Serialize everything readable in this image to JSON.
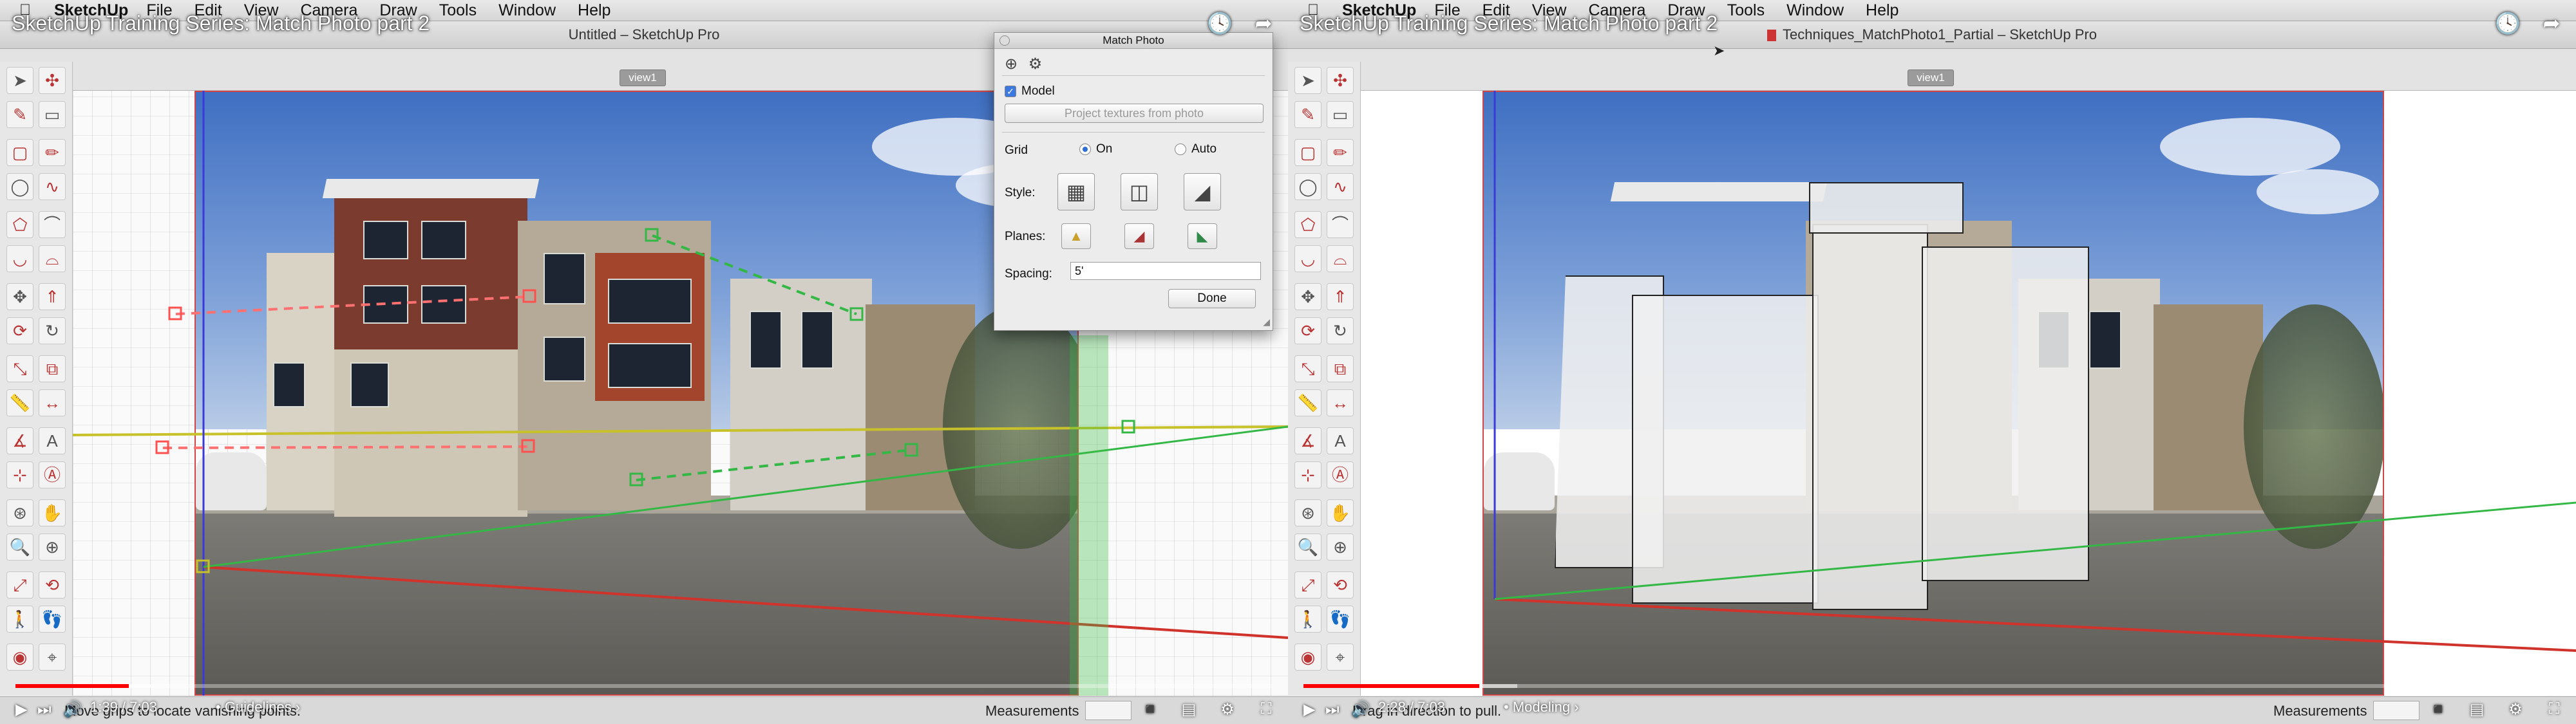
{
  "menu": {
    "apple": "",
    "app": "SketchUp",
    "items": [
      "File",
      "Edit",
      "View",
      "Camera",
      "Draw",
      "Tools",
      "Window",
      "Help"
    ]
  },
  "video_title": "SketchUp Training Series: Match Photo part 2",
  "left": {
    "window_title": "Untitled – SketchUp Pro",
    "scene_tab": "view1",
    "status_hint": "Move grips to locate vanishing points.",
    "measurements_label": "Measurements",
    "time": "1:39 / 7:03",
    "chapter": "• Guidelines ›",
    "progress_played": 0.09,
    "progress_buffered": 0.11
  },
  "right": {
    "window_title": "Techniques_MatchPhoto1_Partial – SketchUp Pro",
    "scene_tab": "view1",
    "status_hint": "Drag in direction to pull.",
    "measurements_label": "Measurements",
    "time": "2:28 / 7:03",
    "chapter": "• Modeling ›",
    "progress_played": 0.14,
    "progress_buffered": 0.17
  },
  "dialog": {
    "title": "Match Photo",
    "model_label": "Model",
    "model_checked": true,
    "project_button": "Project textures from photo",
    "grid_label": "Grid",
    "grid_on": "On",
    "grid_auto": "Auto",
    "grid_selected": "On",
    "style_label": "Style:",
    "planes_label": "Planes:",
    "spacing_label": "Spacing:",
    "spacing_value": "5'",
    "done_button": "Done"
  },
  "colors": {
    "axis_red": "#d0332b",
    "axis_green": "#34b845",
    "axis_blue": "#3a3ad8",
    "horizon": "#c8c22a",
    "youtube_red": "#ff0000"
  },
  "icons": {
    "left_tools": [
      "select-arrow-icon",
      "paint-bucket-icon",
      "paint-icon",
      "eraser-icon",
      "rectangle-icon",
      "pencil-icon",
      "circle-icon",
      "freehand-icon",
      "polygon-icon",
      "arc-icon",
      "shape-icon",
      "arc2-icon",
      "move-icon",
      "push-pull-icon",
      "rotate-icon",
      "follow-me-icon",
      "scale-icon",
      "offset-icon",
      "tape-measure-icon",
      "dimension-icon",
      "protractor-icon",
      "text-icon",
      "axes-icon",
      "3d-text-icon",
      "orbit-icon",
      "pan-icon",
      "zoom-icon",
      "zoom-window-icon",
      "zoom-extents-icon",
      "previous-icon",
      "walk-icon",
      "footprint-icon",
      "look-around-icon",
      "section-plane-icon"
    ]
  }
}
